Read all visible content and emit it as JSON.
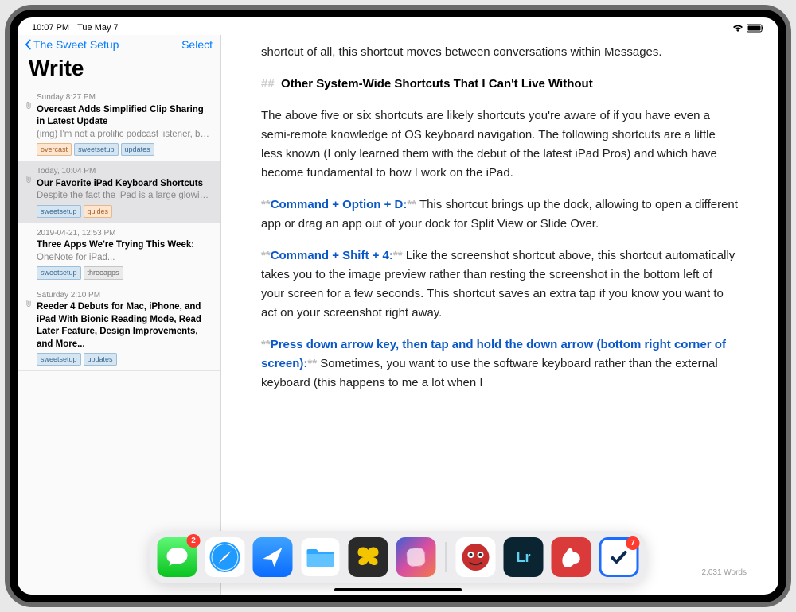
{
  "status": {
    "time": "10:07 PM",
    "date": "Tue May 7"
  },
  "sidebar": {
    "back_label": "The Sweet Setup",
    "select_label": "Select",
    "title": "Write",
    "notes": [
      {
        "date": "Sunday 8:27 PM",
        "title": "Overcast Adds Simplified Clip Sharing in Latest Update",
        "preview": "(img) I'm not a prolific podcast listener, but it...",
        "tags": [
          [
            "overcast",
            "orange"
          ],
          [
            "sweetsetup",
            "blue"
          ],
          [
            "updates",
            "blue"
          ]
        ],
        "clip": true,
        "selected": false
      },
      {
        "date": "Today, 10:04 PM",
        "title": "Our Favorite iPad Keyboard Shortcuts",
        "preview": "Despite the fact the iPad is a large glowing touchscreen, it almost feels like it was built to...",
        "tags": [
          [
            "sweetsetup",
            "blue"
          ],
          [
            "guides",
            "orange"
          ]
        ],
        "clip": true,
        "selected": true
      },
      {
        "date": "2019-04-21, 12:53 PM",
        "title": "Three Apps We're Trying This Week:",
        "preview": "OneNote for iPad...",
        "tags": [
          [
            "sweetsetup",
            "blue"
          ],
          [
            "threeapps",
            "gray"
          ]
        ],
        "clip": false,
        "selected": false
      },
      {
        "date": "Saturday 2:10 PM",
        "title": "Reeder 4 Debuts for Mac, iPhone, and iPad With Bionic Reading Mode, Read Later Feature, Design Improvements, and More...",
        "preview": "",
        "tags": [
          [
            "sweetsetup",
            "blue"
          ],
          [
            "updates",
            "blue"
          ]
        ],
        "clip": true,
        "selected": false
      }
    ]
  },
  "editor": {
    "intro_fragment": "shortcut of all, this shortcut moves between conversations within Messages.",
    "heading_marker": "##",
    "heading": "Other System-Wide Shortcuts That I Can't Live Without",
    "para1": "The above five or six shortcuts are likely shortcuts you're aware of if you have even a semi-remote knowledge of OS keyboard navigation. The following shortcuts are a little less known (I only learned them with the debut of the latest iPad Pros) and which have become fundamental to how I work on the iPad.",
    "sc1_label": "Command + Option + D:",
    "sc1_text": " This shortcut brings up the dock, allowing to open a different app or drag an app out of your dock for Split View or Slide Over.",
    "sc2_label": "Command + Shift + 4:",
    "sc2_text": " Like the screenshot shortcut above, this shortcut automatically takes you to the image preview rather than resting the screenshot in the bottom left of your screen for a few seconds. This shortcut saves an extra tap if you know you want to act on your screenshot right away.",
    "sc3_label": "Press down arrow key, then tap and hold the down arrow (bottom right corner of screen):",
    "sc3_text": " Sometimes, you want to use the software keyboard rather than the external keyboard (this happens to me a lot when I",
    "bold_mark": "**",
    "wordcount": "2,031 Words"
  },
  "dock": {
    "apps": [
      {
        "name": "messages",
        "badge": "2"
      },
      {
        "name": "safari",
        "badge": null
      },
      {
        "name": "spark-mail",
        "badge": null
      },
      {
        "name": "files",
        "badge": null
      },
      {
        "name": "butterfly-app",
        "badge": null
      },
      {
        "name": "shortcuts",
        "badge": null
      },
      {
        "name": "marvis",
        "badge": null
      },
      {
        "name": "lightroom",
        "badge": null
      },
      {
        "name": "bear",
        "badge": null
      },
      {
        "name": "things",
        "badge": "7"
      }
    ],
    "lr_text": "Lr"
  }
}
